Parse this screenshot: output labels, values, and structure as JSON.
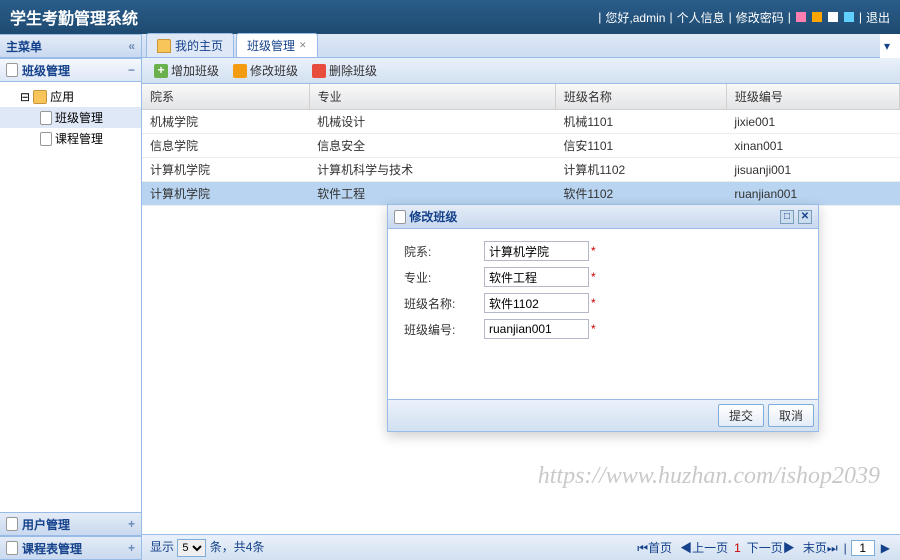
{
  "header": {
    "title": "学生考勤管理系统",
    "greeting": "您好,admin",
    "links": [
      "个人信息",
      "修改密码",
      "退出"
    ],
    "colors": [
      "#ff7fb0",
      "#ffa500",
      "#fff",
      "#5fd0ff"
    ]
  },
  "sidebar": {
    "menu_title": "主菜单",
    "groups": [
      {
        "label": "班级管理",
        "expanded": true
      },
      {
        "label": "用户管理",
        "expanded": false
      },
      {
        "label": "课程表管理",
        "expanded": false
      }
    ],
    "tree": {
      "root": "应用",
      "items": [
        "班级管理",
        "课程管理"
      ]
    }
  },
  "tabs": {
    "home": "我的主页",
    "active": "班级管理"
  },
  "toolbar": {
    "add": "增加班级",
    "edit": "修改班级",
    "del": "删除班级"
  },
  "grid": {
    "columns": [
      "院系",
      "专业",
      "班级名称",
      "班级编号"
    ],
    "rows": [
      [
        "机械学院",
        "机械设计",
        "机械1101",
        "jixie001"
      ],
      [
        "信息学院",
        "信息安全",
        "信安1101",
        "xinan001"
      ],
      [
        "计算机学院",
        "计算机科学与技术",
        "计算机1102",
        "jisuanji001"
      ],
      [
        "计算机学院",
        "软件工程",
        "软件1102",
        "ruanjian001"
      ]
    ],
    "selected": 3
  },
  "status": {
    "show": "显示",
    "per_page": "5",
    "total_tpl": "条，共4条",
    "first": "首页",
    "prev": "上一页",
    "page": "1",
    "next": "下一页",
    "last": "末页",
    "goto": "1"
  },
  "dialog": {
    "title": "修改班级",
    "fields": {
      "dept_label": "院系:",
      "dept_value": "计算机学院",
      "major_label": "专业:",
      "major_value": "软件工程",
      "class_label": "班级名称:",
      "class_value": "软件1102",
      "code_label": "班级编号:",
      "code_value": "ruanjian001"
    },
    "submit": "提交",
    "cancel": "取消"
  },
  "watermark": "https://www.huzhan.com/ishop2039"
}
